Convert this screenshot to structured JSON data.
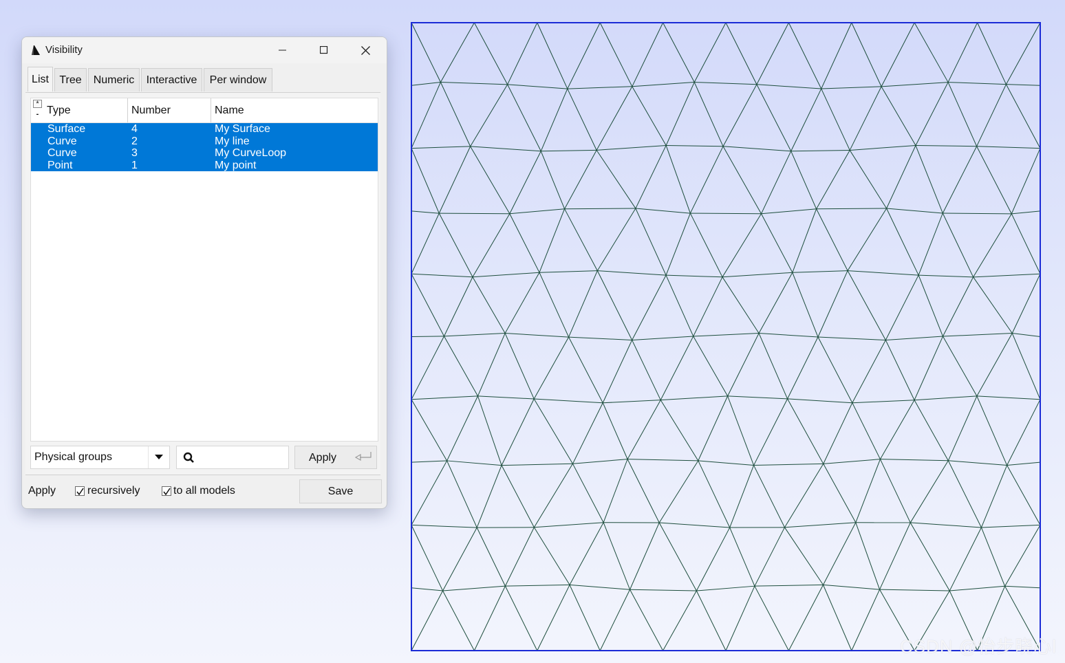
{
  "window": {
    "title": "Visibility"
  },
  "tabs": [
    {
      "label": "List",
      "active": true
    },
    {
      "label": "Tree",
      "active": false
    },
    {
      "label": "Numeric",
      "active": false
    },
    {
      "label": "Interactive",
      "active": false
    },
    {
      "label": "Per window",
      "active": false
    }
  ],
  "list": {
    "toggle_all": "*",
    "toggle_none": "-",
    "columns": [
      "Type",
      "Number",
      "Name"
    ],
    "rows": [
      {
        "type": "Surface",
        "number": "4",
        "name": "My Surface",
        "selected": true
      },
      {
        "type": "Curve",
        "number": "2",
        "name": "My line",
        "selected": true
      },
      {
        "type": "Curve",
        "number": "3",
        "name": "My CurveLoop",
        "selected": true
      },
      {
        "type": "Point",
        "number": "1",
        "name": "My point",
        "selected": true
      }
    ]
  },
  "filter": {
    "selected": "Physical groups",
    "search_value": "",
    "apply_label": "Apply"
  },
  "footer": {
    "apply_label": "Apply",
    "recursively_label": "recursively",
    "recursively_checked": true,
    "all_models_label": "to all models",
    "all_models_checked": true,
    "save_label": "Save"
  },
  "viewport": {
    "mesh_type": "triangular",
    "mesh_color": "#1c4d3c",
    "border_color": "#1a2bd6",
    "background_top": "#d2d9fa",
    "background_bottom": "#f3f5fd"
  },
  "watermark": "CSDN @怡步晓心l",
  "colors": {
    "selection": "#0078d7"
  }
}
